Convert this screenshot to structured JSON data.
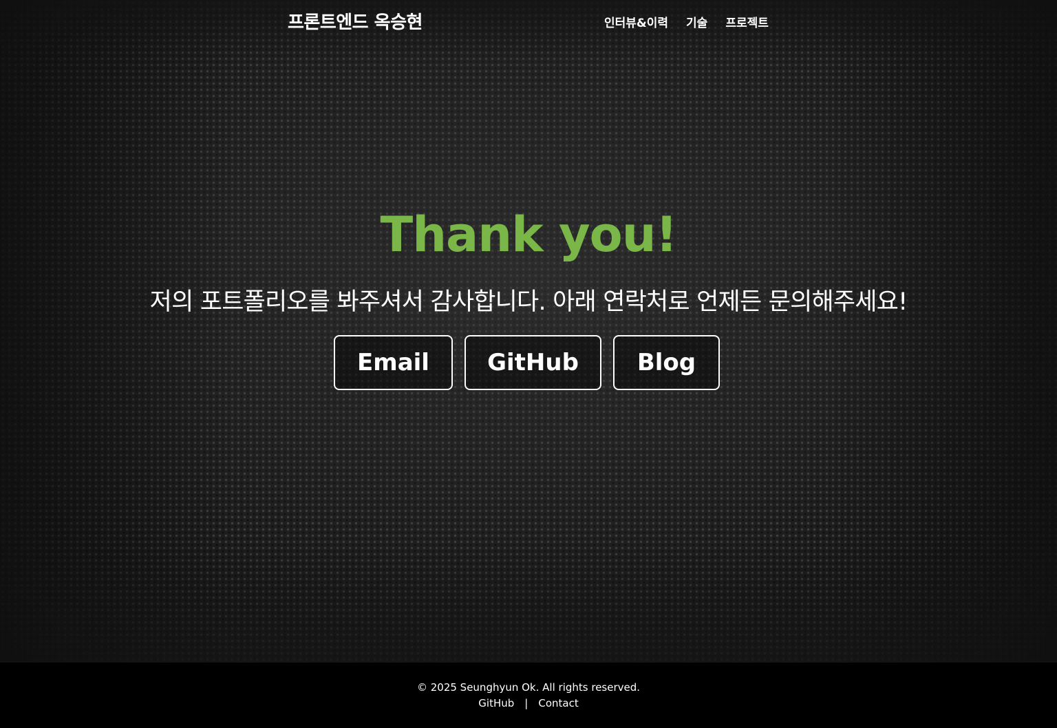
{
  "header": {
    "brand": "프론트엔드 옥승현",
    "nav": [
      {
        "label": "인터뷰&이력"
      },
      {
        "label": "기술"
      },
      {
        "label": "프로젝트"
      }
    ]
  },
  "main": {
    "title": "Thank you!",
    "subtitle": "저의 포트폴리오를 봐주셔서 감사합니다. 아래 연락처로 언제든 문의해주세요!",
    "buttons": [
      {
        "label": "Email"
      },
      {
        "label": "GitHub"
      },
      {
        "label": "Blog"
      }
    ]
  },
  "footer": {
    "copyright": "© 2025 Seunghyun Ok. All rights reserved.",
    "links": [
      {
        "label": "GitHub"
      },
      {
        "label": "Contact"
      }
    ],
    "separator": "|"
  },
  "colors": {
    "accent": "#7ab648",
    "background": "#1a1a1a",
    "footer_bg": "#000000",
    "text": "#ffffff"
  }
}
